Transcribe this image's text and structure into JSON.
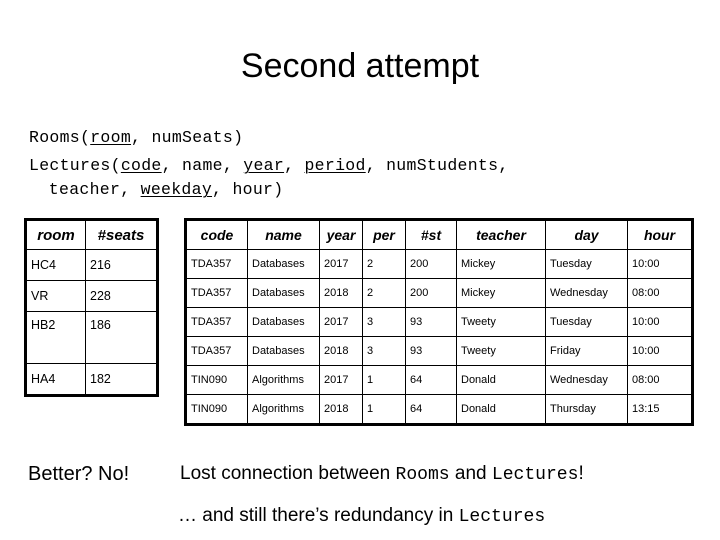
{
  "slide": {
    "title": "Second attempt",
    "background_color": "#ffffff",
    "text_color": "#000000"
  },
  "schema": {
    "rooms": {
      "relation": "Rooms",
      "open": "(",
      "key": "room",
      "sep1": ", ",
      "attr1": "numSeats",
      "close": ")"
    },
    "lectures": {
      "relation": "Lectures",
      "open": "(",
      "key_code": "code",
      "sep1": ", ",
      "attr_name": "name",
      "sep2": ", ",
      "key_year": "year",
      "sep3": ", ",
      "key_period": "period",
      "sep4": ", ",
      "attr_numstudents": "numStudents",
      "sep5": ",",
      "attr_teacher": "teacher",
      "sep6": ", ",
      "key_weekday": "weekday",
      "sep7": ", ",
      "attr_hour": "hour",
      "close": ")"
    }
  },
  "rooms_table": {
    "name": "Rooms",
    "columns": [
      "room",
      "#seats"
    ],
    "rows": [
      [
        "HC4",
        "216"
      ],
      [
        "VR",
        "228"
      ],
      [
        "HB2",
        "186"
      ],
      [
        "HA4",
        "182"
      ]
    ]
  },
  "lectures_table": {
    "name": "Lectures",
    "columns": [
      "code",
      "name",
      "year",
      "per",
      "#st",
      "teacher",
      "day",
      "hour"
    ],
    "rows": [
      [
        "TDA357",
        "Databases",
        "2017",
        "2",
        "200",
        "Mickey",
        "Tuesday",
        "10:00"
      ],
      [
        "TDA357",
        "Databases",
        "2018",
        "2",
        "200",
        "Mickey",
        "Wednesday",
        "08:00"
      ],
      [
        "TDA357",
        "Databases",
        "2017",
        "3",
        "93",
        "Tweety",
        "Tuesday",
        "10:00"
      ],
      [
        "TDA357",
        "Databases",
        "2018",
        "3",
        "93",
        "Tweety",
        "Friday",
        "10:00"
      ],
      [
        "TIN090",
        "Algorithms",
        "2017",
        "1",
        "64",
        "Donald",
        "Wednesday",
        "08:00"
      ],
      [
        "TIN090",
        "Algorithms",
        "2018",
        "1",
        "64",
        "Donald",
        "Thursday",
        "13:15"
      ]
    ]
  },
  "notes": {
    "better": "Better? No!",
    "lost_prefix": "Lost connection between ",
    "lost_rel1": "Rooms",
    "lost_middle": " and ",
    "lost_rel2": "Lectures",
    "lost_suffix": "!",
    "redundancy_prefix": "… and still there’s redundancy in ",
    "redundancy_rel": "Lectures"
  }
}
